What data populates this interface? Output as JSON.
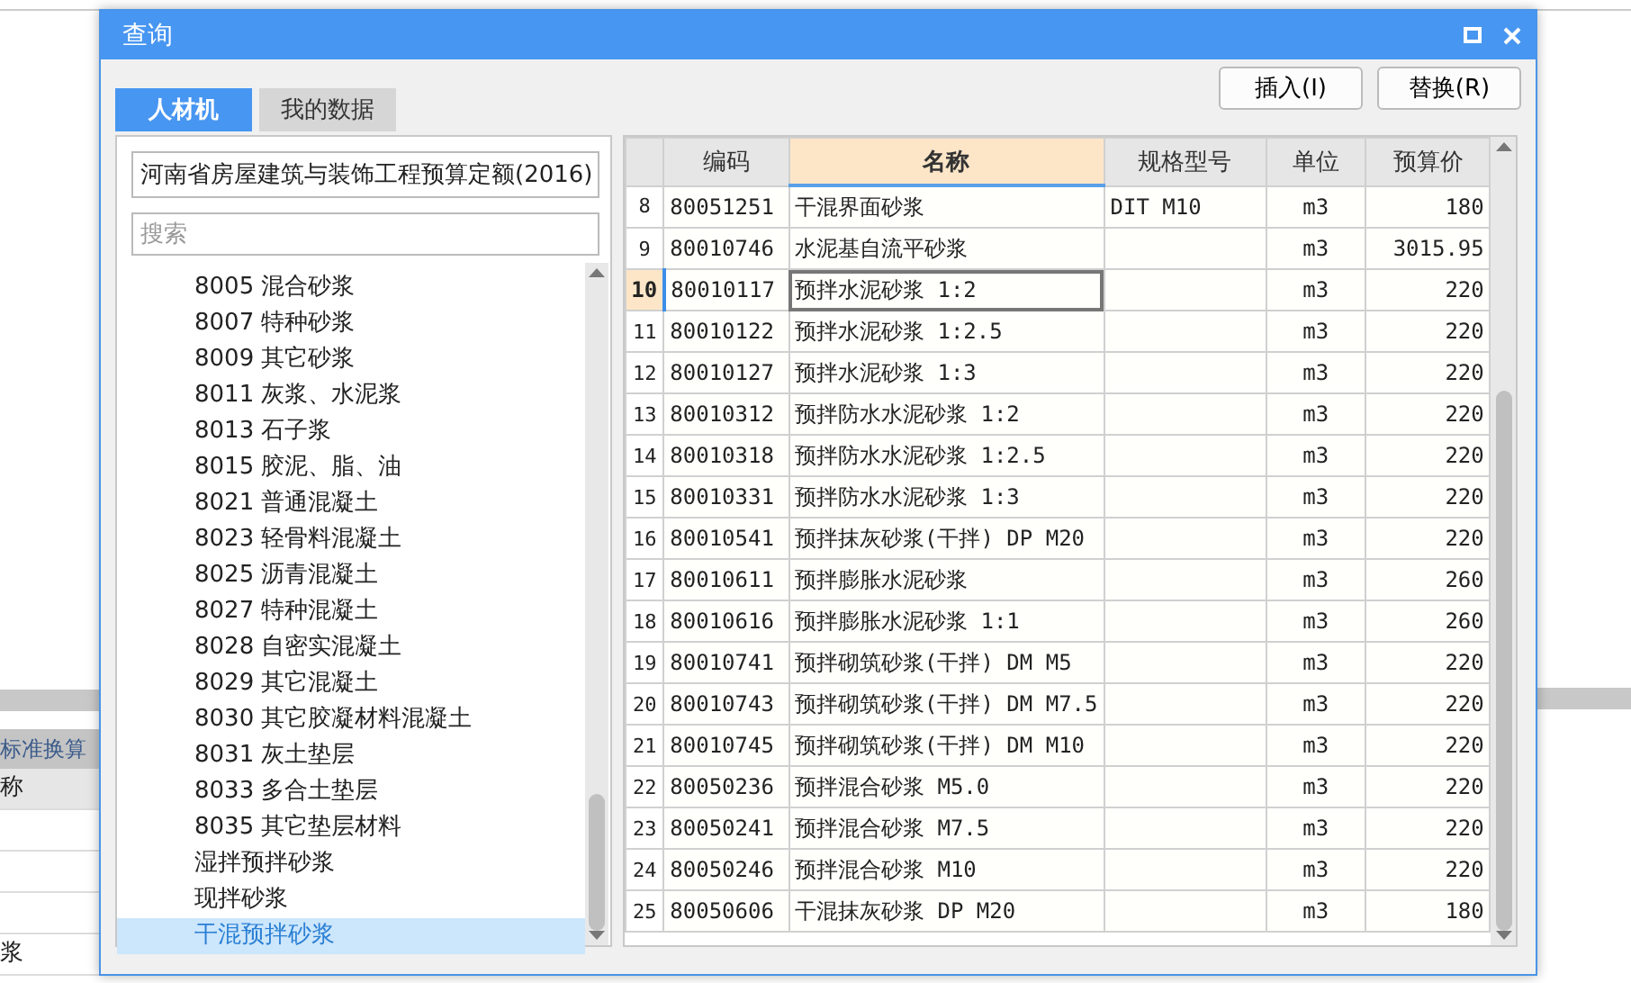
{
  "background": {
    "tab": "标准换算",
    "cells": [
      "称",
      "浆"
    ]
  },
  "dialog": {
    "title": "查询",
    "tabs": [
      {
        "label": "人材机",
        "selected": true
      },
      {
        "label": "我的数据",
        "selected": false
      }
    ],
    "buttons": [
      "插入(I)",
      "替换(R)"
    ],
    "library": {
      "value": "河南省房屋建筑与装饰工程预算定额(2016)"
    },
    "search": {
      "placeholder": "搜索"
    },
    "tree": [
      {
        "label": "8005 混合砂浆",
        "selected": false
      },
      {
        "label": "8007 特种砂浆",
        "selected": false
      },
      {
        "label": "8009 其它砂浆",
        "selected": false
      },
      {
        "label": "8011 灰浆、水泥浆",
        "selected": false
      },
      {
        "label": "8013 石子浆",
        "selected": false
      },
      {
        "label": "8015 胶泥、脂、油",
        "selected": false
      },
      {
        "label": "8021 普通混凝土",
        "selected": false
      },
      {
        "label": "8023 轻骨料混凝土",
        "selected": false
      },
      {
        "label": "8025 沥青混凝土",
        "selected": false
      },
      {
        "label": "8027 特种混凝土",
        "selected": false
      },
      {
        "label": "8028 自密实混凝土",
        "selected": false
      },
      {
        "label": "8029 其它混凝土",
        "selected": false
      },
      {
        "label": "8030 其它胶凝材料混凝土",
        "selected": false
      },
      {
        "label": "8031 灰土垫层",
        "selected": false
      },
      {
        "label": "8033 多合土垫层",
        "selected": false
      },
      {
        "label": "8035 其它垫层材料",
        "selected": false
      },
      {
        "label": "湿拌预拌砂浆",
        "selected": false
      },
      {
        "label": "现拌砂浆",
        "selected": false
      },
      {
        "label": "干混预拌砂浆",
        "selected": true
      }
    ],
    "table": {
      "columns": [
        {
          "label": "编码",
          "selected": false
        },
        {
          "label": "名称",
          "selected": true
        },
        {
          "label": "规格型号",
          "selected": false
        },
        {
          "label": "单位",
          "selected": false
        },
        {
          "label": "预算价",
          "selected": false
        }
      ],
      "rows": [
        {
          "no": "8",
          "code": "80051251",
          "name": "干混界面砂浆",
          "spec": "DIT M10",
          "unit": "m3",
          "price": "180",
          "selected": false
        },
        {
          "no": "9",
          "code": "80010746",
          "name": "水泥基自流平砂浆",
          "unit": "m3",
          "price": "3015.95",
          "selected": false
        },
        {
          "no": "10",
          "code": "80010117",
          "name": "预拌水泥砂浆 1:2",
          "unit": "m3",
          "price": "220",
          "selected": true
        },
        {
          "no": "11",
          "code": "80010122",
          "name": "预拌水泥砂浆 1:2.5",
          "unit": "m3",
          "price": "220",
          "selected": false
        },
        {
          "no": "12",
          "code": "80010127",
          "name": "预拌水泥砂浆 1:3",
          "unit": "m3",
          "price": "220",
          "selected": false
        },
        {
          "no": "13",
          "code": "80010312",
          "name": "预拌防水水泥砂浆 1:2",
          "unit": "m3",
          "price": "220",
          "selected": false
        },
        {
          "no": "14",
          "code": "80010318",
          "name": "预拌防水水泥砂浆 1:2.5",
          "unit": "m3",
          "price": "220",
          "selected": false
        },
        {
          "no": "15",
          "code": "80010331",
          "name": "预拌防水水泥砂浆 1:3",
          "unit": "m3",
          "price": "220",
          "selected": false
        },
        {
          "no": "16",
          "code": "80010541",
          "name": "预拌抹灰砂浆(干拌) DP M20",
          "unit": "m3",
          "price": "220",
          "selected": false
        },
        {
          "no": "17",
          "code": "80010611",
          "name": "预拌膨胀水泥砂浆",
          "unit": "m3",
          "price": "260",
          "selected": false
        },
        {
          "no": "18",
          "code": "80010616",
          "name": "预拌膨胀水泥砂浆 1:1",
          "unit": "m3",
          "price": "260",
          "selected": false
        },
        {
          "no": "19",
          "code": "80010741",
          "name": "预拌砌筑砂浆(干拌) DM M5",
          "unit": "m3",
          "price": "220",
          "selected": false
        },
        {
          "no": "20",
          "code": "80010743",
          "name": "预拌砌筑砂浆(干拌) DM M7.5",
          "unit": "m3",
          "price": "220",
          "selected": false
        },
        {
          "no": "21",
          "code": "80010745",
          "name": "预拌砌筑砂浆(干拌) DM M10",
          "unit": "m3",
          "price": "220",
          "selected": false
        },
        {
          "no": "22",
          "code": "80050236",
          "name": "预拌混合砂浆 M5.0",
          "unit": "m3",
          "price": "220",
          "selected": false
        },
        {
          "no": "23",
          "code": "80050241",
          "name": "预拌混合砂浆 M7.5",
          "unit": "m3",
          "price": "220",
          "selected": false
        },
        {
          "no": "24",
          "code": "80050246",
          "name": "预拌混合砂浆 M10",
          "unit": "m3",
          "price": "220",
          "selected": false
        },
        {
          "no": "25",
          "code": "80050606",
          "name": "干混抹灰砂浆 DP M20",
          "unit": "m3",
          "price": "180",
          "selected": false
        }
      ]
    }
  }
}
